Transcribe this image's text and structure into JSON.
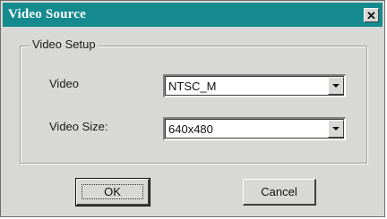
{
  "window": {
    "title": "Video Source",
    "close_glyph": "✕",
    "close_icon": "close-icon"
  },
  "group": {
    "legend": "Video Setup",
    "video_label": "Video",
    "video_value": "NTSC_M",
    "size_label": "Video Size:",
    "size_value": "640x480"
  },
  "buttons": {
    "ok": "OK",
    "cancel": "Cancel"
  },
  "colors": {
    "titlebar": "#168b8f",
    "face": "#d8d9d6"
  }
}
